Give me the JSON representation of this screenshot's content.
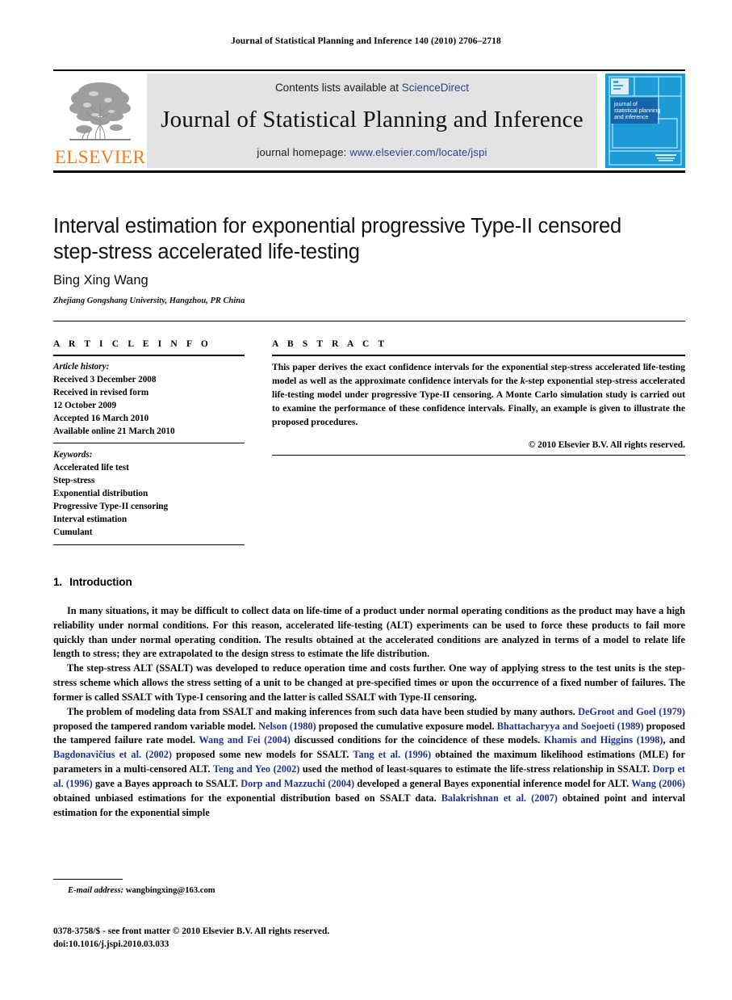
{
  "running_head": "Journal of Statistical Planning and Inference 140 (2010) 2706–2718",
  "masthead": {
    "contents_prefix": "Contents lists available at ",
    "sciencedirect": "ScienceDirect",
    "journal_name": "Journal of Statistical Planning and Inference",
    "homepage_prefix": "journal homepage: ",
    "homepage_url": "www.elsevier.com/locate/jspi",
    "publisher": "ELSEVIER",
    "cover_title_line1": "journal of",
    "cover_title_line2": "statistical planning",
    "cover_title_line3": "and inference",
    "accent_link": "#2b3f8c",
    "elsevier_orange": "#F07C1E",
    "cover_blue": "#1d9bd7"
  },
  "article": {
    "title": "Interval estimation for exponential progressive Type-II censored step-stress accelerated life-testing",
    "author": "Bing Xing Wang",
    "affiliation": "Zhejiang Gongshang University, Hangzhou, PR China"
  },
  "info": {
    "label": "A R T I C L E    I N F O",
    "history_label": "Article history:",
    "history_lines": [
      "Received 3 December 2008",
      "Received in revised form",
      "12 October 2009",
      "Accepted 16 March 2010",
      "Available online 21 March 2010"
    ],
    "keywords_label": "Keywords:",
    "keywords": [
      "Accelerated life test",
      "Step-stress",
      "Exponential distribution",
      "Progressive Type-II censoring",
      "Interval estimation",
      "Cumulant"
    ]
  },
  "abstract": {
    "label": "A B S T R A C T",
    "part1": "This paper derives the exact confidence intervals for the exponential step-stress accelerated life-testing model as well as the approximate confidence intervals for the ",
    "k_italic": "k",
    "part2": "-step exponential step-stress accelerated life-testing model under progressive Type-II censoring. A Monte Carlo simulation study is carried out to examine the performance of these confidence intervals. Finally, an example is given to illustrate the proposed procedures.",
    "copyright": "© 2010 Elsevier B.V. All rights reserved."
  },
  "introduction": {
    "number": "1.",
    "heading": "Introduction",
    "paragraph1": "In many situations, it may be difficult to collect data on life-time of a product under normal operating conditions as the product may have a high reliability under normal conditions. For this reason, accelerated life-testing (ALT) experiments can be used to force these products to fail more quickly than under normal operating condition. The results obtained at the accelerated conditions are analyzed in terms of a model to relate life length to stress; they are extrapolated to the design stress to estimate the life distribution.",
    "paragraph2": "The step-stress ALT (SSALT) was developed to reduce operation time and costs further. One way of applying stress to the test units is the step-stress scheme which allows the stress setting of a unit to be changed at pre-specified times or upon the occurrence of a fixed number of failures. The former is called SSALT with Type-I censoring and the latter is called SSALT with Type-II censoring.",
    "paragraph3_segments": [
      {
        "text": "The problem of modeling data from SSALT and making inferences from such data have been studied by many authors. ",
        "cite": false
      },
      {
        "text": "DeGroot and Goel (1979)",
        "cite": true
      },
      {
        "text": " proposed the tampered random variable model. ",
        "cite": false
      },
      {
        "text": "Nelson (1980)",
        "cite": true
      },
      {
        "text": " proposed the cumulative exposure model. ",
        "cite": false
      },
      {
        "text": "Bhattacharyya and Soejoeti (1989)",
        "cite": true
      },
      {
        "text": " proposed the tampered failure rate model. ",
        "cite": false
      },
      {
        "text": "Wang and Fei (2004)",
        "cite": true
      },
      {
        "text": " discussed conditions for the coincidence of these models. ",
        "cite": false
      },
      {
        "text": "Khamis and Higgins (1998)",
        "cite": true
      },
      {
        "text": ", and ",
        "cite": false
      },
      {
        "text": "Bagdonavičius et al. (2002)",
        "cite": true
      },
      {
        "text": " proposed some new models for SSALT. ",
        "cite": false
      },
      {
        "text": "Tang et al. (1996)",
        "cite": true
      },
      {
        "text": " obtained the maximum likelihood estimations (MLE) for parameters in a multi-censored ALT. ",
        "cite": false
      },
      {
        "text": "Teng and Yeo (2002)",
        "cite": true
      },
      {
        "text": " used the method of least-squares to estimate the life-stress relationship in SSALT. ",
        "cite": false
      },
      {
        "text": "Dorp et al. (1996)",
        "cite": true
      },
      {
        "text": " gave a Bayes approach to SSALT. ",
        "cite": false
      },
      {
        "text": "Dorp and Mazzuchi (2004)",
        "cite": true
      },
      {
        "text": " developed a general Bayes exponential inference model for ALT. ",
        "cite": false
      },
      {
        "text": "Wang (2006)",
        "cite": true
      },
      {
        "text": " obtained unbiased estimations for the exponential distribution based on SSALT data. ",
        "cite": false
      },
      {
        "text": "Balakrishnan et al. (2007)",
        "cite": true
      },
      {
        "text": " obtained point and interval estimation for the exponential simple",
        "cite": false
      }
    ]
  },
  "footer": {
    "email_label": "E-mail address:",
    "email": "wangbingxing@163.com",
    "imprint_line1": "0378-3758/$ - see front matter © 2010 Elsevier B.V. All rights reserved.",
    "imprint_line2": "doi:10.1016/j.jspi.2010.03.033"
  }
}
